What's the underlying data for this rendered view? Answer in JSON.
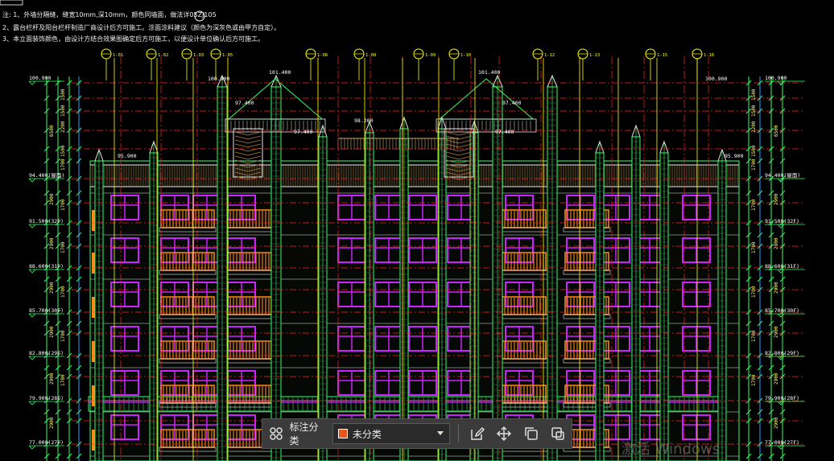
{
  "drawing": {
    "notes": [
      "注: 1、外墙分隔缝，缝宽10mm,深10mm，颜色同墙面，做法详05ZJ105",
      "2、露台栏杆及阳台栏杆制造厂商设计后方可施工。涂面涂料建议（颜色为深灰色或由甲方自定）。",
      "3、本立面装饰颜色，由设计方结合效果图确定后方可施工，以便设计单位确认后方可施工。"
    ],
    "top_elevations": [
      "101.400",
      "101.400",
      "100.900",
      "100.900"
    ],
    "left_levels": [
      {
        "label": "100.900"
      },
      {
        "label": "94.400(屋面)"
      },
      {
        "label": "91.500(32F)"
      },
      {
        "label": "88.600(31F)"
      },
      {
        "label": "85.700(30F)"
      },
      {
        "label": "82.800(29F)"
      },
      {
        "label": "79.900(28F)"
      },
      {
        "label": "77.000(27F)"
      }
    ],
    "right_levels": [
      {
        "label": "100.900"
      },
      {
        "label": "94.400(屋面)"
      },
      {
        "label": "91.500(32F)"
      },
      {
        "label": "88.600(31F)"
      },
      {
        "label": "85.700(30F)"
      },
      {
        "label": "82.800(29F)"
      },
      {
        "label": "79.900(28F)"
      },
      {
        "label": "77.000(27F)"
      }
    ],
    "dims_left_outer": [
      "6500",
      "2900",
      "2900",
      "2900",
      "2900",
      "2900",
      "2900"
    ],
    "dims_left_inner": [
      "1500",
      "1500",
      "2200",
      "1500",
      "1700",
      "1700",
      "1700",
      "1700",
      "1700",
      "1700"
    ],
    "mid_elevations": [
      "97.400",
      "97.400",
      "98.200",
      "95.900",
      "95.900",
      "97.400",
      "97.400"
    ],
    "axis_bubbles": [
      "1-01",
      "1-02",
      "1-03",
      "1-05",
      "1-06",
      "1-08",
      "1-09",
      "1-10",
      "1-12",
      "1-13",
      "1-15",
      "1-16"
    ],
    "colors": {
      "background": "#000000",
      "grid_red": "#ff2020",
      "grid_yellow": "#ffff00",
      "building_green": "#33ff66",
      "window_magenta": "#cc22ff",
      "balcony_orange": "#ff8a1a",
      "facade_white": "#e6e6e6"
    }
  },
  "toolbar": {
    "grid_icon": "grid-icon",
    "label": "标注分类",
    "select_value": "未分类",
    "select_swatch": "#e8561d",
    "buttons": [
      "edit-icon",
      "move-icon",
      "copy-icon",
      "paste-icon"
    ]
  },
  "watermark": "激活 Windows"
}
